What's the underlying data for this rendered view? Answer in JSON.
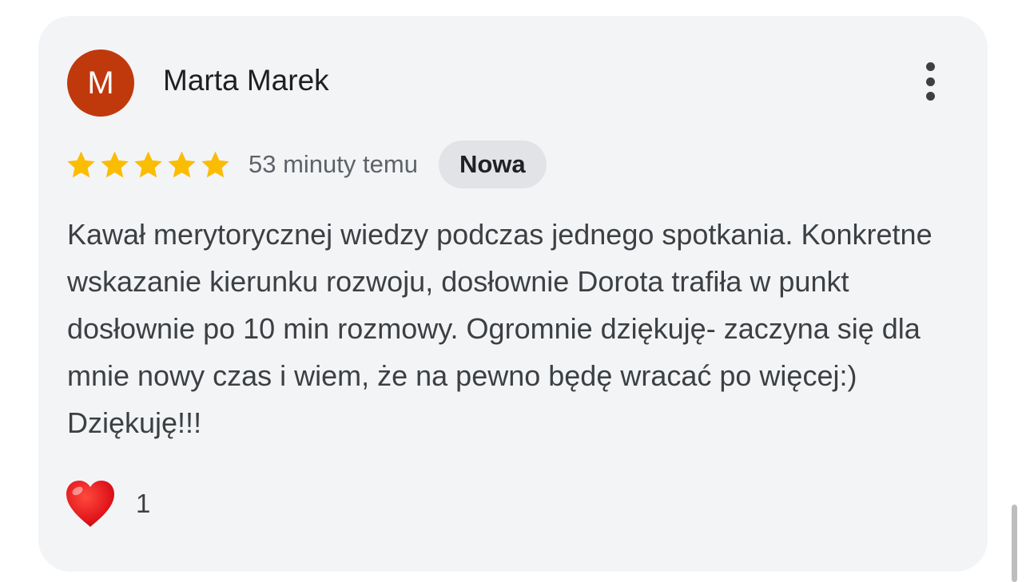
{
  "review": {
    "author": {
      "initial": "M",
      "name": "Marta Marek",
      "avatar_color": "#c0390d"
    },
    "menu_icon": "more-vertical-icon",
    "rating": {
      "stars": 5,
      "max_stars": 5,
      "star_color": "#fbbc04"
    },
    "time_ago": "53 minuty temu",
    "badge": "Nowa",
    "text": "Kawał merytorycznej wiedzy podczas jednego spotkania. Konkretne wskazanie kierunku rozwoju, dosłownie Dorota trafiła w punkt dosłownie po 10 min rozmowy. Ogromnie dziękuję- zaczyna się dla mnie nowy czas i wiem, że na pewno będę wracać po więcej:) Dziękuję!!!",
    "reaction": {
      "icon": "heart-icon",
      "count": "1"
    }
  }
}
